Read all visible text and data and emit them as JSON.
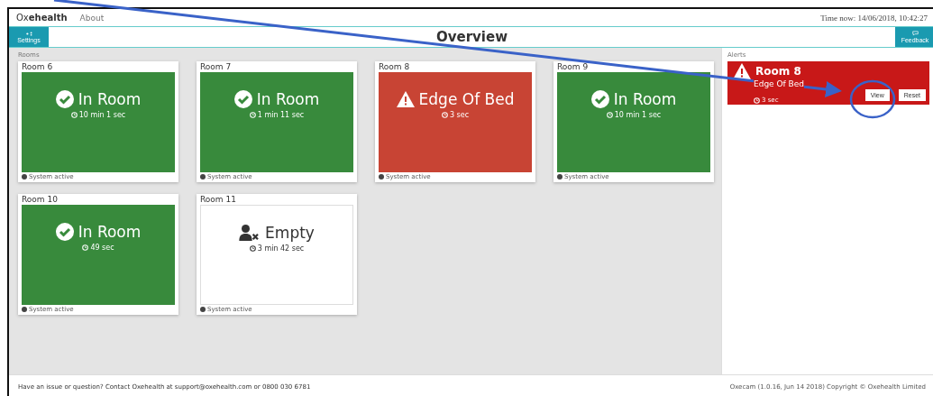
{
  "nav": {
    "brand_light": "Ox",
    "brand_bold": "ehealth",
    "links": [
      "About"
    ],
    "time": "Time now: 14/06/2018, 10:42:27"
  },
  "header": {
    "title": "Overview",
    "left_button": "Settings",
    "right_button": "Feedback"
  },
  "rooms": {
    "label": "Rooms",
    "items": [
      {
        "name": "Room 6",
        "kind": "in_room",
        "status": "In Room",
        "duration": "10 min 1 sec",
        "footer": "System active"
      },
      {
        "name": "Room 7",
        "kind": "in_room",
        "status": "In Room",
        "duration": "1 min 11 sec",
        "footer": "System active"
      },
      {
        "name": "Room 8",
        "kind": "edge_of_bed",
        "status": "Edge Of Bed",
        "duration": "3 sec",
        "footer": "System active"
      },
      {
        "name": "Room 9",
        "kind": "in_room",
        "status": "In Room",
        "duration": "10 min 1 sec",
        "footer": "System active"
      },
      {
        "name": "Room 10",
        "kind": "in_room",
        "status": "In Room",
        "duration": "49 sec",
        "footer": "System active"
      },
      {
        "name": "Room 11",
        "kind": "empty",
        "status": "Empty",
        "duration": "3 min 42 sec",
        "footer": "System active"
      }
    ]
  },
  "alerts": {
    "label": "Alerts",
    "items": [
      {
        "room": "Room 8",
        "status": "Edge Of Bed",
        "duration": "3 sec",
        "buttons": [
          "View",
          "Reset"
        ]
      }
    ]
  },
  "footer": {
    "contact": "Have an issue or question? Contact Oxehealth at support@oxehealth.com or 0800 030 6781",
    "version": "Oxecam (1.0.16, Jun 14 2018) Copyright © Oxehealth Limited"
  }
}
